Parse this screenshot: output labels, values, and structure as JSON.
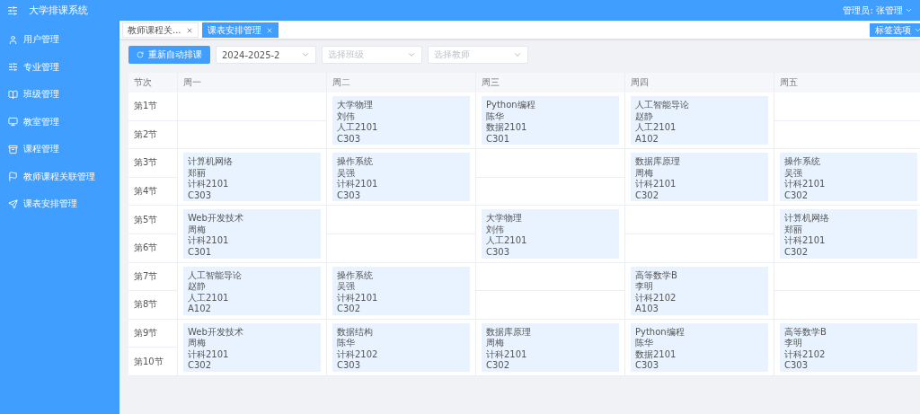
{
  "app_title": "大学排课系统",
  "user_menu": {
    "label": "管理员: 张管理"
  },
  "sidebar": {
    "items": [
      {
        "label": "用户管理"
      },
      {
        "label": "专业管理"
      },
      {
        "label": "班级管理"
      },
      {
        "label": "教室管理"
      },
      {
        "label": "课程管理"
      },
      {
        "label": "教师课程关联管理"
      },
      {
        "label": "课表安排管理"
      }
    ]
  },
  "tabs": [
    {
      "label": "教师课程关...",
      "selected": false
    },
    {
      "label": "课表安排管理",
      "selected": true
    }
  ],
  "tab_options_button": "标签选项",
  "toolbar": {
    "reschedule_button": "重新自动排课",
    "term_select": {
      "value": "2024-2025-2"
    },
    "class_select": {
      "placeholder": "选择班级"
    },
    "teacher_select": {
      "placeholder": "选择教师"
    }
  },
  "timetable": {
    "slot_header": "节次",
    "days": [
      "周一",
      "周二",
      "周三",
      "周四",
      "周五"
    ],
    "periods": [
      "第1节",
      "第2节",
      "第3节",
      "第4节",
      "第5节",
      "第6节",
      "第7节",
      "第8节",
      "第9节",
      "第10节"
    ],
    "columns": [
      [
        null,
        {
          "course": "计算机网络",
          "teacher": "郑丽",
          "class": "计科2101",
          "room": "C303"
        },
        {
          "course": "Web开发技术",
          "teacher": "周梅",
          "class": "计科2101",
          "room": "C301"
        },
        {
          "course": "人工智能导论",
          "teacher": "赵静",
          "class": "人工2101",
          "room": "A102"
        },
        {
          "course": "Web开发技术",
          "teacher": "周梅",
          "class": "计科2101",
          "room": "C302"
        }
      ],
      [
        {
          "course": "大学物理",
          "teacher": "刘伟",
          "class": "人工2101",
          "room": "C303"
        },
        {
          "course": "操作系统",
          "teacher": "吴强",
          "class": "计科2101",
          "room": "C303"
        },
        null,
        {
          "course": "操作系统",
          "teacher": "吴强",
          "class": "计科2101",
          "room": "C302"
        },
        {
          "course": "数据结构",
          "teacher": "陈华",
          "class": "计科2102",
          "room": "C303"
        }
      ],
      [
        {
          "course": "Python编程",
          "teacher": "陈华",
          "class": "数据2101",
          "room": "C301"
        },
        null,
        {
          "course": "大学物理",
          "teacher": "刘伟",
          "class": "人工2101",
          "room": "C303"
        },
        null,
        {
          "course": "数据库原理",
          "teacher": "周梅",
          "class": "计科2101",
          "room": "C302"
        }
      ],
      [
        {
          "course": "人工智能导论",
          "teacher": "赵静",
          "class": "人工2101",
          "room": "A102"
        },
        {
          "course": "数据库原理",
          "teacher": "周梅",
          "class": "计科2101",
          "room": "C302"
        },
        null,
        {
          "course": "高等数学B",
          "teacher": "李明",
          "class": "计科2102",
          "room": "A103"
        },
        {
          "course": "Python编程",
          "teacher": "陈华",
          "class": "数据2101",
          "room": "C303"
        }
      ],
      [
        null,
        {
          "course": "操作系统",
          "teacher": "吴强",
          "class": "计科2101",
          "room": "C302"
        },
        {
          "course": "计算机网络",
          "teacher": "郑丽",
          "class": "计科2101",
          "room": "C302"
        },
        null,
        {
          "course": "高等数学B",
          "teacher": "李明",
          "class": "计科2102",
          "room": "C303"
        }
      ]
    ]
  }
}
